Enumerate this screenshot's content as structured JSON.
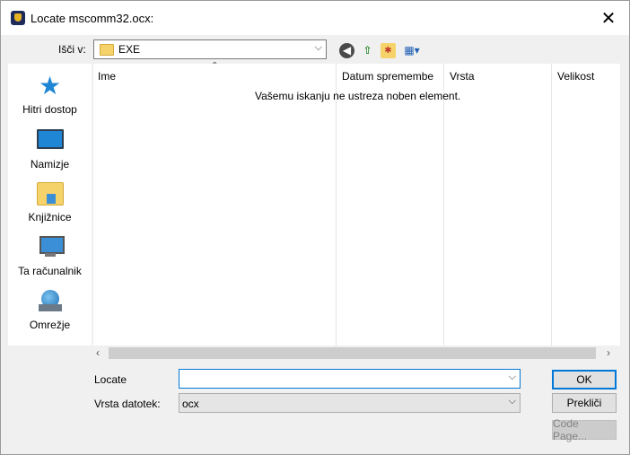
{
  "window": {
    "title": "Locate mscomm32.ocx:",
    "close_glyph": "✕"
  },
  "lookin": {
    "label": "Išči v:",
    "value": "EXE",
    "arrow": "⌵"
  },
  "toolbar_icons": [
    "back-icon",
    "up-folder-icon",
    "new-folder-icon",
    "view-menu-icon"
  ],
  "places": [
    {
      "label": "Hitri dostop",
      "icon": "quick-access-star-icon"
    },
    {
      "label": "Namizje",
      "icon": "desktop-icon"
    },
    {
      "label": "Knjižnice",
      "icon": "libraries-icon"
    },
    {
      "label": "Ta računalnik",
      "icon": "computer-icon"
    },
    {
      "label": "Omrežje",
      "icon": "network-icon"
    }
  ],
  "list": {
    "columns": [
      "Ime",
      "Datum spremembe",
      "Vrsta",
      "Velikost"
    ],
    "empty_message": "Vašemu iskanju ne ustreza noben element."
  },
  "filename": {
    "label": "Locate",
    "value": ""
  },
  "filetype": {
    "label": "Vrsta datotek:",
    "value": "ocx"
  },
  "buttons": {
    "ok": "OK",
    "cancel": "Prekliči",
    "codepage": "Code Page..."
  },
  "colors": {
    "accent": "#0078d7",
    "folder": "#f6d36a"
  }
}
